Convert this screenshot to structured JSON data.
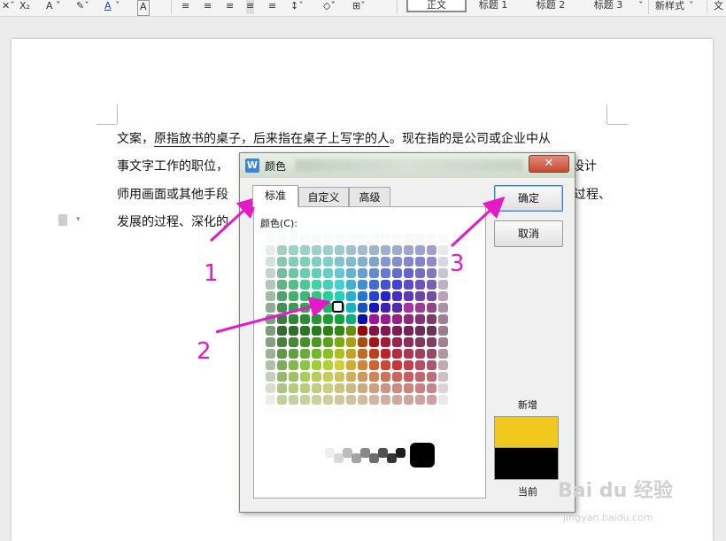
{
  "toolbar": {
    "font_color_label": "A",
    "paragraph_style_label": "正文",
    "heading1_label": "标题 1",
    "heading2_label": "标题 2",
    "heading3_label": "标题 3",
    "new_style_label": "新样式"
  },
  "document": {
    "lines": [
      "文案，原指放书的桌子，后来指在桌子上写字的人。现在指的是公司或企业中从",
      "事文字工作的职位，",
      "师用画面或其他手段",
      "发展的过程、深化的"
    ],
    "line1_parts": [
      "文案，",
      "原指放书的桌子，后来指在桌子上写字的人",
      "。现在指的是公司或企业中从"
    ],
    "line2_tail": "设计",
    "line3_tail": "过程、"
  },
  "dialog": {
    "title": "颜色",
    "close_label": "✕",
    "tabs": [
      "标准",
      "自定义",
      "高级"
    ],
    "active_tab": "标准",
    "color_label": "颜色(C):",
    "ok_label": "确定",
    "cancel_label": "取消",
    "new_label": "新增",
    "current_label": "当前",
    "new_color": "#f0c81e",
    "current_color": "#000000"
  },
  "annotations": [
    "1",
    "2",
    "3"
  ],
  "watermark": {
    "text": "Bai du 经验",
    "url": "jingyan.baidu.com"
  },
  "colors": {
    "annotation_arrow": "#e619c7",
    "ok_border": "#3b82c4"
  }
}
